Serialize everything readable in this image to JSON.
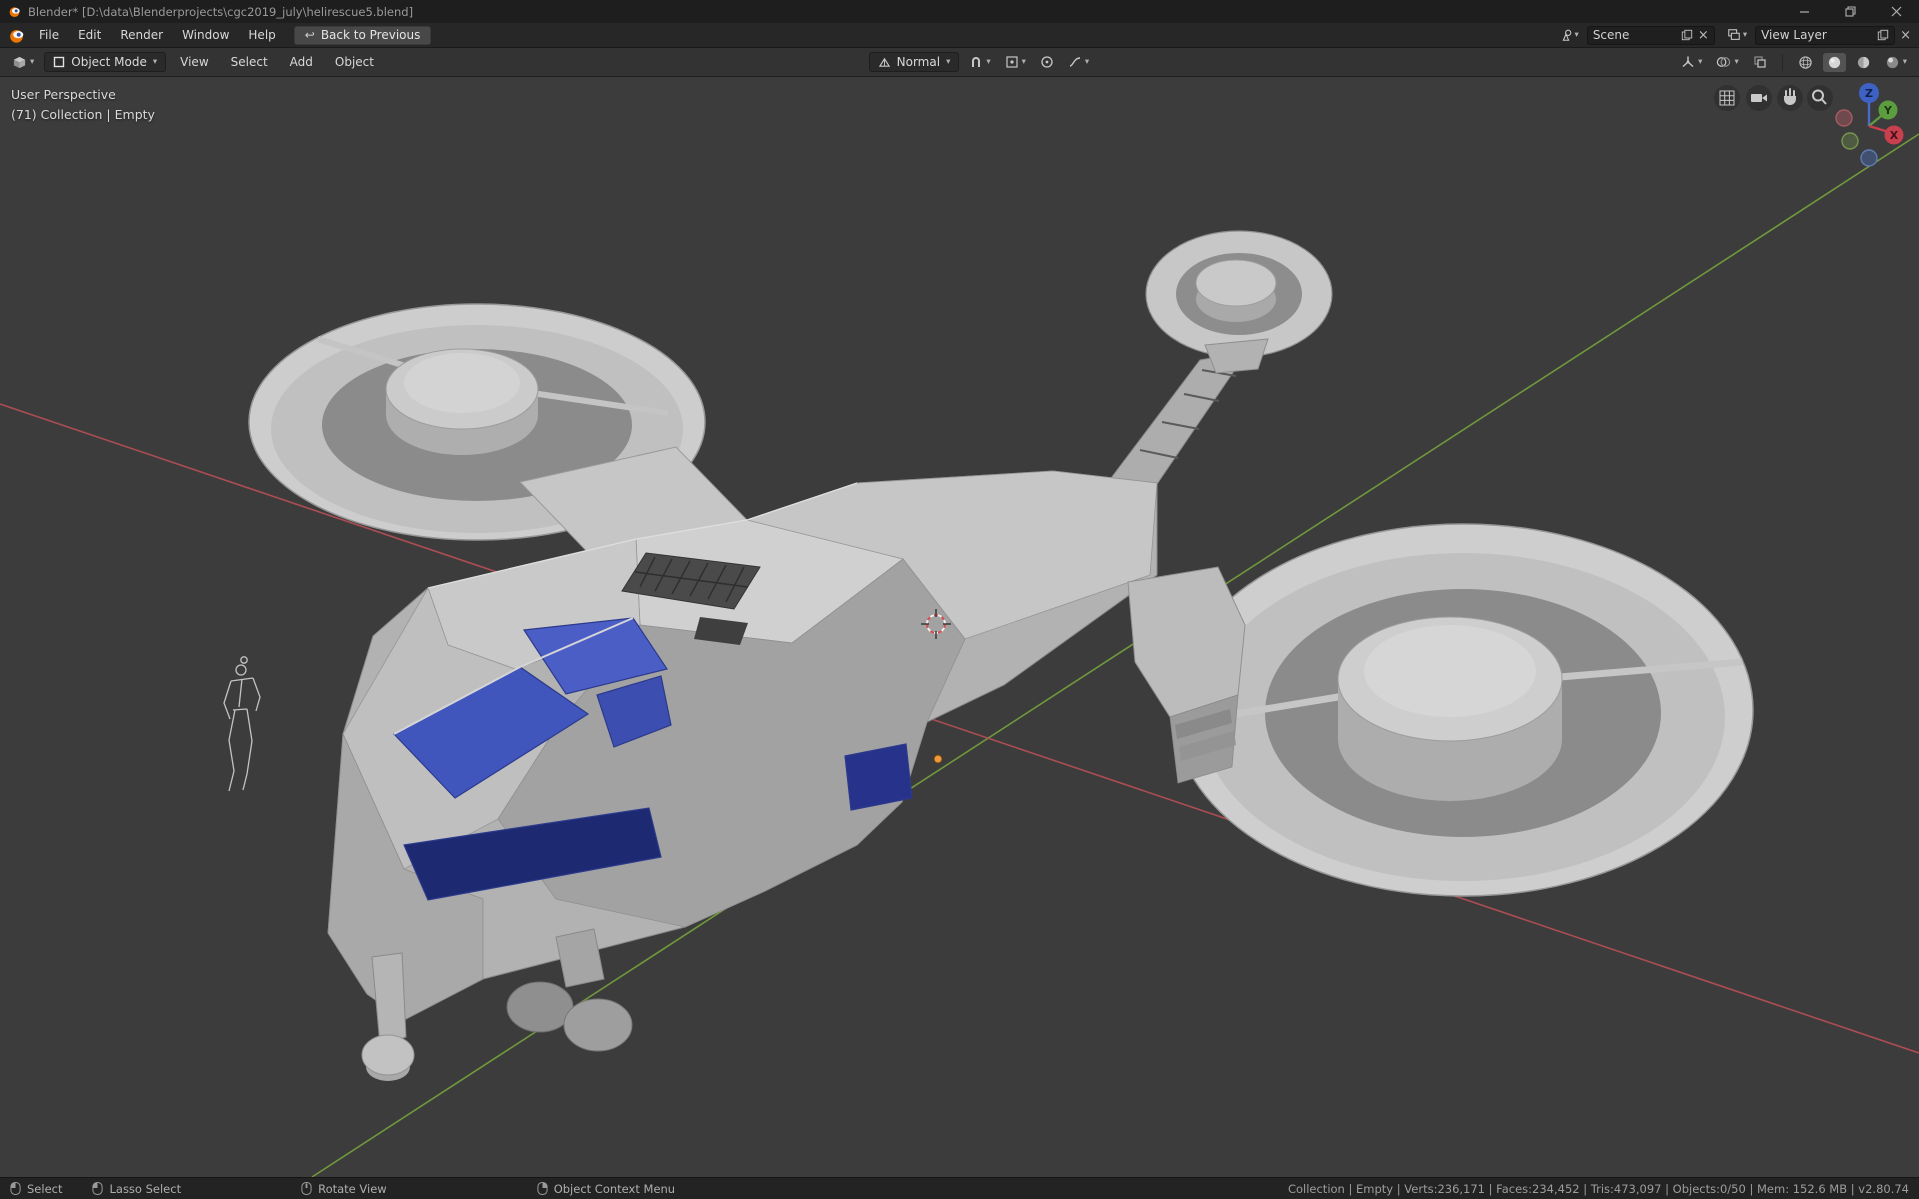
{
  "window": {
    "title": "Blender* [D:\\data\\Blenderprojects\\cgc2019_july\\helirescue5.blend]"
  },
  "icons": {
    "chevron_down": "▾",
    "close_small": "×",
    "back_arrow": "↩"
  },
  "menubar": {
    "menus": [
      "File",
      "Edit",
      "Render",
      "Window",
      "Help"
    ],
    "back_label": "Back to Previous",
    "scene_label": "Scene",
    "view_layer_label": "View Layer"
  },
  "tool_header": {
    "mode_label": "Object Mode",
    "menus": [
      "View",
      "Select",
      "Add",
      "Object"
    ],
    "orientation_label": "Normal"
  },
  "viewport": {
    "header_text": {
      "line1": "User Perspective",
      "line2": "(71) Collection | Empty"
    },
    "gizmo": {
      "x": "X",
      "y": "Y",
      "z": "Z"
    }
  },
  "status_bar": {
    "hints": [
      {
        "button": "LMB",
        "label": "Select"
      },
      {
        "button": "LMB",
        "label": "Lasso Select"
      },
      {
        "button": "MMB",
        "label": "Rotate View"
      },
      {
        "button": "RMB",
        "label": "Object Context Menu"
      }
    ],
    "stats": "Collection | Empty | Verts:236,171 | Faces:234,452 | Tris:473,097 | Objects:0/50 | Mem: 152.6 MB | v2.80.74"
  },
  "colors": {
    "axis_x": "#bf5058",
    "axis_y": "#79a93c",
    "canopy_blue": "#4156bd",
    "selection_orange": "#ee9a3c"
  }
}
